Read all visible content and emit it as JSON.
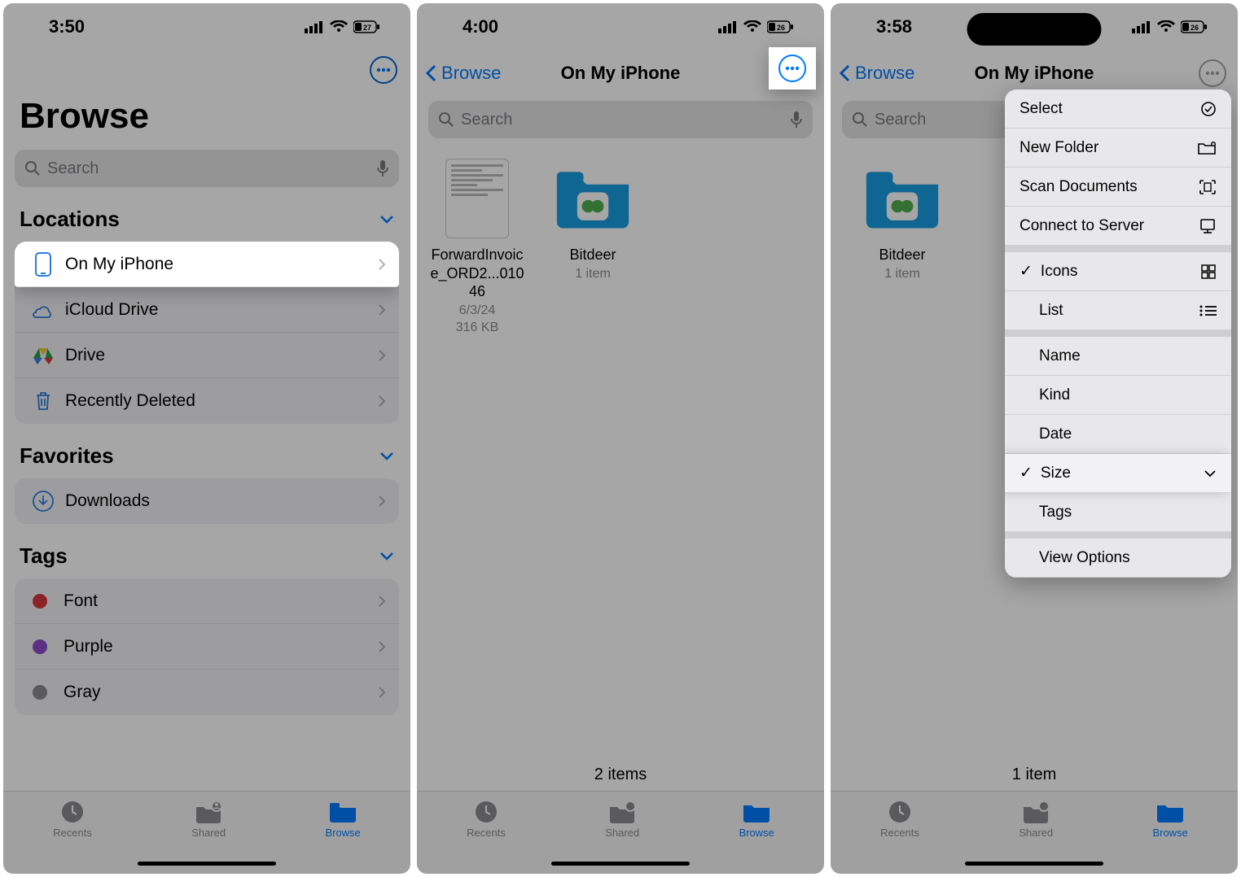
{
  "screens": [
    {
      "status": {
        "time": "3:50",
        "battery": "27"
      },
      "title": "Browse",
      "search_placeholder": "Search",
      "sections": {
        "locations": {
          "label": "Locations",
          "items": [
            {
              "label": "On My iPhone",
              "highlight": true
            },
            {
              "label": "iCloud Drive"
            },
            {
              "label": "Drive"
            },
            {
              "label": "Recently Deleted"
            }
          ]
        },
        "favorites": {
          "label": "Favorites",
          "items": [
            {
              "label": "Downloads"
            }
          ]
        },
        "tags": {
          "label": "Tags",
          "items": [
            {
              "label": "Font",
              "color": "#d8373c"
            },
            {
              "label": "Purple",
              "color": "#8c4bcb"
            },
            {
              "label": "Gray",
              "color": "#8a8a8e"
            }
          ]
        }
      },
      "tabs": {
        "recents": "Recents",
        "shared": "Shared",
        "browse": "Browse"
      }
    },
    {
      "status": {
        "time": "4:00",
        "battery": "26"
      },
      "nav": {
        "back": "Browse",
        "title": "On My iPhone"
      },
      "search_placeholder": "Search",
      "files": [
        {
          "name": "ForwardInvoice_ORD2...01046",
          "date": "6/3/24",
          "size": "316 KB",
          "type": "doc"
        },
        {
          "name": "Bitdeer",
          "meta": "1 item",
          "type": "folder"
        }
      ],
      "count": "2 items",
      "tabs": {
        "recents": "Recents",
        "shared": "Shared",
        "browse": "Browse"
      }
    },
    {
      "status": {
        "time": "3:58",
        "battery": "26"
      },
      "nav": {
        "back": "Browse",
        "title": "On My iPhone"
      },
      "search_placeholder": "Search",
      "files": [
        {
          "name": "Bitdeer",
          "meta": "1 item",
          "type": "folder"
        }
      ],
      "count": "1 item",
      "menu": {
        "actions": [
          {
            "label": "Select"
          },
          {
            "label": "New Folder"
          },
          {
            "label": "Scan Documents"
          },
          {
            "label": "Connect to Server"
          }
        ],
        "views": [
          {
            "label": "Icons",
            "checked": true
          },
          {
            "label": "List"
          }
        ],
        "sorts": [
          {
            "label": "Name"
          },
          {
            "label": "Kind"
          },
          {
            "label": "Date"
          },
          {
            "label": "Size",
            "checked": true,
            "highlight": true
          },
          {
            "label": "Tags"
          }
        ],
        "last": {
          "label": "View Options"
        }
      },
      "tabs": {
        "recents": "Recents",
        "shared": "Shared",
        "browse": "Browse"
      }
    }
  ]
}
